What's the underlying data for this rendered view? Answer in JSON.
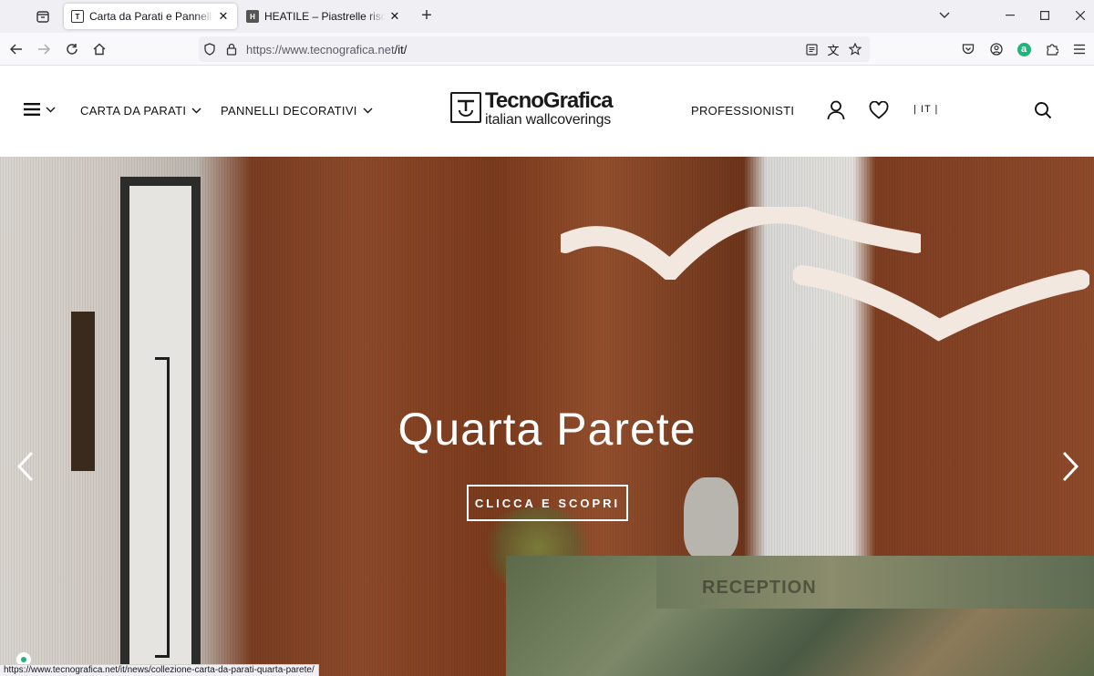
{
  "browser": {
    "tabs": [
      {
        "title": "Carta da Parati e Pannelli Decorativi",
        "active": true
      },
      {
        "title": "HEATILE – Piastrelle riscaldanti di design",
        "active": false
      }
    ],
    "url_host": "https://www.tecnografica.net",
    "url_path": "/it/",
    "status_url": "https://www.tecnografica.net/it/news/collezione-carta-da-parati-quarta-parete/"
  },
  "header": {
    "nav": [
      {
        "label": "CARTA DA PARATI"
      },
      {
        "label": "PANNELLI DECORATIVI"
      }
    ],
    "logo_brand": "TecnoGrafica",
    "logo_tagline": "italian wallcoverings",
    "professionals": "PROFESSIONISTI",
    "language": "| IT |"
  },
  "hero": {
    "title": "Quarta Parete",
    "cta": "CLICCA E SCOPRI",
    "sign_text": "RECEPTION"
  },
  "colors": {
    "accent_chat": "#1fb47a",
    "header_text": "#111111"
  }
}
